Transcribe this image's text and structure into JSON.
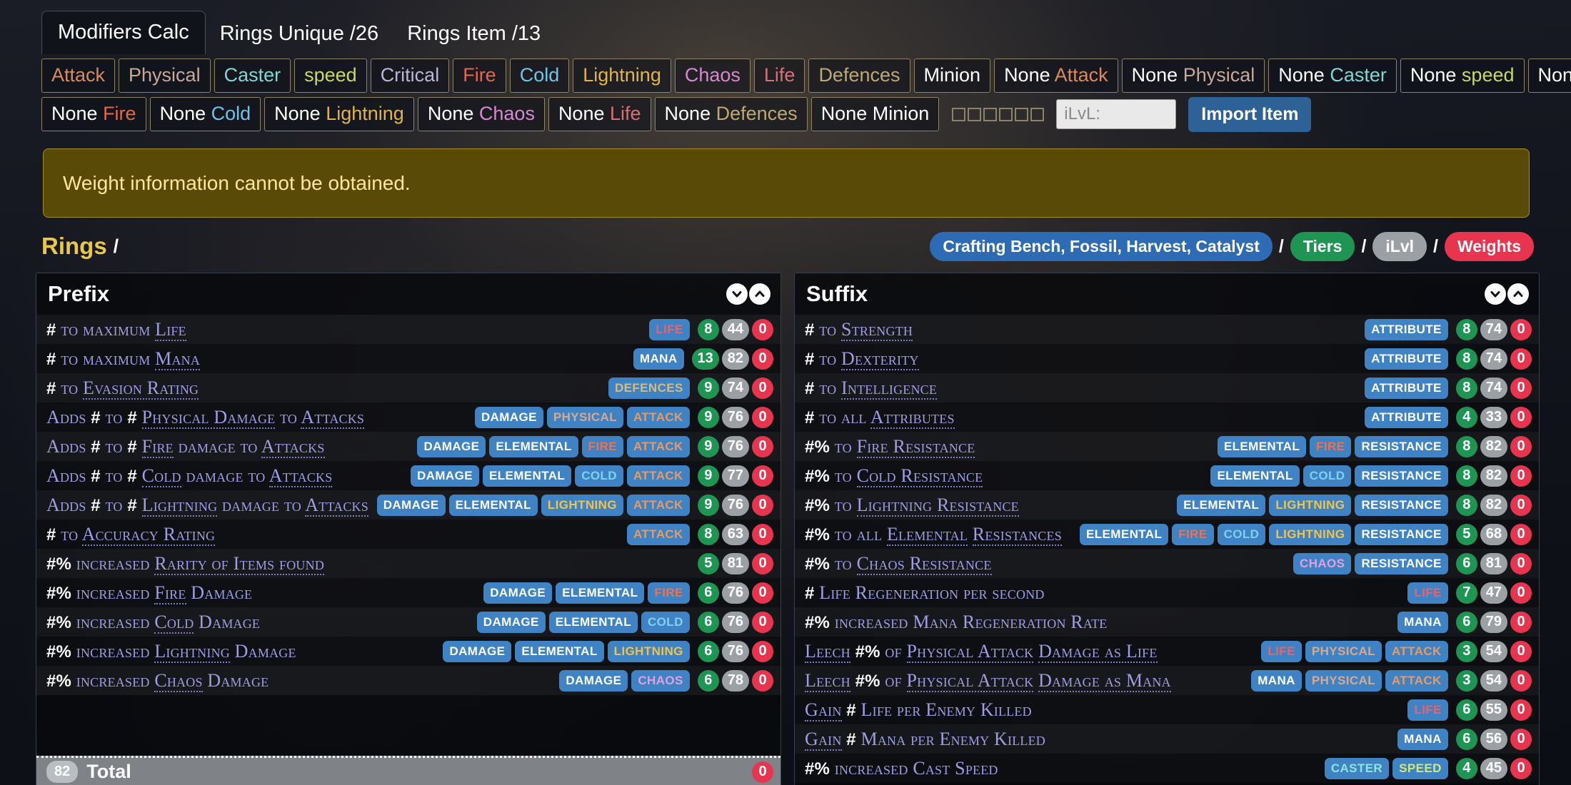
{
  "tabs": [
    {
      "label": "Modifiers Calc",
      "active": true
    },
    {
      "label": "Rings Unique /26",
      "active": false
    },
    {
      "label": "Rings Item /13",
      "active": false
    }
  ],
  "filter_row_1": [
    {
      "prefix": "",
      "label": "Attack",
      "color": "#d98a5e"
    },
    {
      "prefix": "",
      "label": "Physical",
      "color": "#c7a99a"
    },
    {
      "prefix": "",
      "label": "Caster",
      "color": "#7fd8d0"
    },
    {
      "prefix": "",
      "label": "speed",
      "color": "#c6d86a"
    },
    {
      "prefix": "",
      "label": "Critical",
      "color": "#b8b6d8"
    },
    {
      "prefix": "",
      "label": "Fire",
      "color": "#e06a4a"
    },
    {
      "prefix": "",
      "label": "Cold",
      "color": "#6fc4e8"
    },
    {
      "prefix": "",
      "label": "Lightning",
      "color": "#e0b44a"
    },
    {
      "prefix": "",
      "label": "Chaos",
      "color": "#d58ad0"
    },
    {
      "prefix": "",
      "label": "Life",
      "color": "#d8707a"
    },
    {
      "prefix": "",
      "label": "Defences",
      "color": "#bfa878"
    },
    {
      "prefix": "",
      "label": "Minion",
      "color": "#ffffff"
    },
    {
      "prefix": "None ",
      "label": "Attack",
      "color": "#d98a5e"
    },
    {
      "prefix": "None ",
      "label": "Physical",
      "color": "#c7a99a"
    },
    {
      "prefix": "None ",
      "label": "Caster",
      "color": "#7fd8d0"
    },
    {
      "prefix": "None ",
      "label": "speed",
      "color": "#c6d86a"
    },
    {
      "prefix": "None ",
      "label": "Critical",
      "color": "#b8b6d8"
    }
  ],
  "filter_row_2": [
    {
      "prefix": "None ",
      "label": "Fire",
      "color": "#e06a4a"
    },
    {
      "prefix": "None ",
      "label": "Cold",
      "color": "#6fc4e8"
    },
    {
      "prefix": "None ",
      "label": "Lightning",
      "color": "#e0b44a"
    },
    {
      "prefix": "None ",
      "label": "Chaos",
      "color": "#d58ad0"
    },
    {
      "prefix": "None ",
      "label": "Life",
      "color": "#d8707a"
    },
    {
      "prefix": "None ",
      "label": "Defences",
      "color": "#bfa878"
    },
    {
      "prefix": "None ",
      "label": "Minion",
      "color": "#ffffff"
    }
  ],
  "checkbox_count": 6,
  "ilvl": {
    "placeholder": "iLvL:",
    "value": ""
  },
  "import_button": "Import Item",
  "warning": "Weight information cannot be obtained.",
  "rings": {
    "title": "Rings",
    "slash": "/"
  },
  "header_pills": [
    {
      "label": "Crafting Bench, Fossil, Harvest, Catalyst",
      "style": "blue"
    },
    {
      "label": "Tiers",
      "style": "green"
    },
    {
      "label": "iLvl",
      "style": "gray"
    },
    {
      "label": "Weights",
      "style": "red"
    }
  ],
  "pill_separator": "/",
  "colors": {
    "accent_gold": "#e8c84a",
    "tag_blue": "#3f83c4",
    "num_green": "#1e9553",
    "num_gray": "#9ba0a5",
    "num_red": "#e8354f",
    "mod_text": "#9f9ee4",
    "warning_bg": "#594a07",
    "warning_text": "#ffe79a",
    "import_blue": "#2e6196"
  },
  "tag_colors": {
    "DAMAGE": "#ffffff",
    "PHYSICAL": "#d9a890",
    "ELEMENTAL": "#ffffff",
    "FIRE": "#f0714a",
    "COLD": "#7fd0f5",
    "LIGHTNING": "#f0c44a",
    "CHAOS": "#e3a0dd",
    "ATTACK": "#e89a62",
    "CASTER": "#8fe5dd",
    "SPEED": "#d2e87a",
    "LIFE": "#e8636e",
    "MANA": "#ffffff",
    "DEFENCES": "#d2bc84",
    "ATTRIBUTE": "#ffffff",
    "RESISTANCE": "#ffffff"
  },
  "prefix": {
    "title": "Prefix",
    "rows": [
      {
        "parts": [
          {
            "t": "#",
            "k": "hash"
          },
          {
            "t": " to maximum ",
            "k": "p"
          },
          {
            "t": "Life",
            "k": "u"
          }
        ],
        "tags": [
          "LIFE"
        ],
        "nums": [
          8,
          44,
          0
        ]
      },
      {
        "parts": [
          {
            "t": "#",
            "k": "hash"
          },
          {
            "t": " to maximum ",
            "k": "p"
          },
          {
            "t": "Mana",
            "k": "u"
          }
        ],
        "tags": [
          "MANA"
        ],
        "nums": [
          13,
          82,
          0
        ]
      },
      {
        "parts": [
          {
            "t": "#",
            "k": "hash"
          },
          {
            "t": " to ",
            "k": "p"
          },
          {
            "t": "Evasion Rating",
            "k": "u"
          }
        ],
        "tags": [
          "DEFENCES"
        ],
        "nums": [
          9,
          74,
          0
        ]
      },
      {
        "parts": [
          {
            "t": "Adds ",
            "k": "p"
          },
          {
            "t": "#",
            "k": "hash"
          },
          {
            "t": " to ",
            "k": "p"
          },
          {
            "t": "#",
            "k": "hash"
          },
          {
            "t": " ",
            "k": "p"
          },
          {
            "t": "Physical Damage",
            "k": "u"
          },
          {
            "t": " to ",
            "k": "p"
          },
          {
            "t": "Attacks",
            "k": "u"
          }
        ],
        "tags": [
          "DAMAGE",
          "PHYSICAL",
          "ATTACK"
        ],
        "nums": [
          9,
          76,
          0
        ]
      },
      {
        "parts": [
          {
            "t": "Adds ",
            "k": "p"
          },
          {
            "t": "#",
            "k": "hash"
          },
          {
            "t": " to ",
            "k": "p"
          },
          {
            "t": "#",
            "k": "hash"
          },
          {
            "t": " ",
            "k": "p"
          },
          {
            "t": "Fire",
            "k": "u"
          },
          {
            "t": " damage to ",
            "k": "p"
          },
          {
            "t": "Attacks",
            "k": "u"
          }
        ],
        "tags": [
          "DAMAGE",
          "ELEMENTAL",
          "FIRE",
          "ATTACK"
        ],
        "nums": [
          9,
          76,
          0
        ]
      },
      {
        "parts": [
          {
            "t": "Adds ",
            "k": "p"
          },
          {
            "t": "#",
            "k": "hash"
          },
          {
            "t": " to ",
            "k": "p"
          },
          {
            "t": "#",
            "k": "hash"
          },
          {
            "t": " ",
            "k": "p"
          },
          {
            "t": "Cold",
            "k": "u"
          },
          {
            "t": " damage to ",
            "k": "p"
          },
          {
            "t": "Attacks",
            "k": "u"
          }
        ],
        "tags": [
          "DAMAGE",
          "ELEMENTAL",
          "COLD",
          "ATTACK"
        ],
        "nums": [
          9,
          77,
          0
        ]
      },
      {
        "parts": [
          {
            "t": "Adds ",
            "k": "p"
          },
          {
            "t": "#",
            "k": "hash"
          },
          {
            "t": " to ",
            "k": "p"
          },
          {
            "t": "#",
            "k": "hash"
          },
          {
            "t": " ",
            "k": "p"
          },
          {
            "t": "Lightning",
            "k": "u"
          },
          {
            "t": " damage to ",
            "k": "p"
          },
          {
            "t": "Attacks",
            "k": "u"
          }
        ],
        "tags": [
          "DAMAGE",
          "ELEMENTAL",
          "LIGHTNING",
          "ATTACK"
        ],
        "nums": [
          9,
          76,
          0
        ]
      },
      {
        "parts": [
          {
            "t": "#",
            "k": "hash"
          },
          {
            "t": " to ",
            "k": "p"
          },
          {
            "t": "Accuracy Rating",
            "k": "u"
          }
        ],
        "tags": [
          "ATTACK"
        ],
        "nums": [
          8,
          63,
          0
        ]
      },
      {
        "parts": [
          {
            "t": "#%",
            "k": "hash"
          },
          {
            "t": " increased ",
            "k": "p"
          },
          {
            "t": "Rarity of Items found",
            "k": "u"
          }
        ],
        "tags": [],
        "nums": [
          5,
          81,
          0
        ]
      },
      {
        "parts": [
          {
            "t": "#%",
            "k": "hash"
          },
          {
            "t": " increased ",
            "k": "p"
          },
          {
            "t": "Fire",
            "k": "u"
          },
          {
            "t": " Damage",
            "k": "p"
          }
        ],
        "tags": [
          "DAMAGE",
          "ELEMENTAL",
          "FIRE"
        ],
        "nums": [
          6,
          76,
          0
        ]
      },
      {
        "parts": [
          {
            "t": "#%",
            "k": "hash"
          },
          {
            "t": " increased ",
            "k": "p"
          },
          {
            "t": "Cold",
            "k": "u"
          },
          {
            "t": " Damage",
            "k": "p"
          }
        ],
        "tags": [
          "DAMAGE",
          "ELEMENTAL",
          "COLD"
        ],
        "nums": [
          6,
          76,
          0
        ]
      },
      {
        "parts": [
          {
            "t": "#%",
            "k": "hash"
          },
          {
            "t": " increased ",
            "k": "p"
          },
          {
            "t": "Lightning",
            "k": "u"
          },
          {
            "t": " Damage",
            "k": "p"
          }
        ],
        "tags": [
          "DAMAGE",
          "ELEMENTAL",
          "LIGHTNING"
        ],
        "nums": [
          6,
          76,
          0
        ]
      },
      {
        "parts": [
          {
            "t": "#%",
            "k": "hash"
          },
          {
            "t": " increased ",
            "k": "p"
          },
          {
            "t": "Chaos",
            "k": "u"
          },
          {
            "t": " Damage",
            "k": "p"
          }
        ],
        "tags": [
          "DAMAGE",
          "CHAOS"
        ],
        "nums": [
          6,
          78,
          0
        ]
      }
    ],
    "total": {
      "count": 82,
      "label": "Total",
      "right": 0
    }
  },
  "suffix": {
    "title": "Suffix",
    "rows": [
      {
        "parts": [
          {
            "t": "#",
            "k": "hash"
          },
          {
            "t": " to ",
            "k": "p"
          },
          {
            "t": "Strength",
            "k": "u"
          }
        ],
        "tags": [
          "ATTRIBUTE"
        ],
        "nums": [
          8,
          74,
          0
        ]
      },
      {
        "parts": [
          {
            "t": "#",
            "k": "hash"
          },
          {
            "t": " to ",
            "k": "p"
          },
          {
            "t": "Dexterity",
            "k": "u"
          }
        ],
        "tags": [
          "ATTRIBUTE"
        ],
        "nums": [
          8,
          74,
          0
        ]
      },
      {
        "parts": [
          {
            "t": "#",
            "k": "hash"
          },
          {
            "t": " to ",
            "k": "p"
          },
          {
            "t": "Intelligence",
            "k": "u"
          }
        ],
        "tags": [
          "ATTRIBUTE"
        ],
        "nums": [
          8,
          74,
          0
        ]
      },
      {
        "parts": [
          {
            "t": "#",
            "k": "hash"
          },
          {
            "t": " to all ",
            "k": "p"
          },
          {
            "t": "Attributes",
            "k": "u"
          }
        ],
        "tags": [
          "ATTRIBUTE"
        ],
        "nums": [
          4,
          33,
          0
        ]
      },
      {
        "parts": [
          {
            "t": "#%",
            "k": "hash"
          },
          {
            "t": " to ",
            "k": "p"
          },
          {
            "t": "Fire Resistance",
            "k": "u"
          }
        ],
        "tags": [
          "ELEMENTAL",
          "FIRE",
          "RESISTANCE"
        ],
        "nums": [
          8,
          82,
          0
        ]
      },
      {
        "parts": [
          {
            "t": "#%",
            "k": "hash"
          },
          {
            "t": " to ",
            "k": "p"
          },
          {
            "t": "Cold Resistance",
            "k": "u"
          }
        ],
        "tags": [
          "ELEMENTAL",
          "COLD",
          "RESISTANCE"
        ],
        "nums": [
          8,
          82,
          0
        ]
      },
      {
        "parts": [
          {
            "t": "#%",
            "k": "hash"
          },
          {
            "t": " to ",
            "k": "p"
          },
          {
            "t": "Lightning Resistance",
            "k": "u"
          }
        ],
        "tags": [
          "ELEMENTAL",
          "LIGHTNING",
          "RESISTANCE"
        ],
        "nums": [
          8,
          82,
          0
        ]
      },
      {
        "parts": [
          {
            "t": "#%",
            "k": "hash"
          },
          {
            "t": " to all ",
            "k": "p"
          },
          {
            "t": "Elemental",
            "k": "u"
          },
          {
            "t": " ",
            "k": "p"
          },
          {
            "t": "Resistances",
            "k": "u"
          }
        ],
        "tags": [
          "ELEMENTAL",
          "FIRE",
          "COLD",
          "LIGHTNING",
          "RESISTANCE"
        ],
        "nums": [
          5,
          68,
          0
        ]
      },
      {
        "parts": [
          {
            "t": "#%",
            "k": "hash"
          },
          {
            "t": " to ",
            "k": "p"
          },
          {
            "t": "Chaos Resistance",
            "k": "u"
          }
        ],
        "tags": [
          "CHAOS",
          "RESISTANCE"
        ],
        "nums": [
          6,
          81,
          0
        ]
      },
      {
        "parts": [
          {
            "t": "#",
            "k": "hash"
          },
          {
            "t": " ",
            "k": "p"
          },
          {
            "t": "Life Regeneration per second",
            "k": "p"
          }
        ],
        "tags": [
          "LIFE"
        ],
        "nums": [
          7,
          47,
          0
        ]
      },
      {
        "parts": [
          {
            "t": "#%",
            "k": "hash"
          },
          {
            "t": " increased ",
            "k": "p"
          },
          {
            "t": "Mana Regeneration Rate",
            "k": "p"
          }
        ],
        "tags": [
          "MANA"
        ],
        "nums": [
          6,
          79,
          0
        ]
      },
      {
        "parts": [
          {
            "t": "Leech",
            "k": "u"
          },
          {
            "t": " ",
            "k": "p"
          },
          {
            "t": "#%",
            "k": "hash"
          },
          {
            "t": " of ",
            "k": "p"
          },
          {
            "t": "Physical Attack",
            "k": "u"
          },
          {
            "t": " ",
            "k": "p"
          },
          {
            "t": "Damage as Life",
            "k": "u"
          }
        ],
        "tags": [
          "LIFE",
          "PHYSICAL",
          "ATTACK"
        ],
        "nums": [
          3,
          54,
          0
        ]
      },
      {
        "parts": [
          {
            "t": "Leech",
            "k": "u"
          },
          {
            "t": " ",
            "k": "p"
          },
          {
            "t": "#%",
            "k": "hash"
          },
          {
            "t": " of ",
            "k": "p"
          },
          {
            "t": "Physical Attack",
            "k": "u"
          },
          {
            "t": " ",
            "k": "p"
          },
          {
            "t": "Damage as Mana",
            "k": "u"
          }
        ],
        "tags": [
          "MANA",
          "PHYSICAL",
          "ATTACK"
        ],
        "nums": [
          3,
          54,
          0
        ]
      },
      {
        "parts": [
          {
            "t": "Gain",
            "k": "u"
          },
          {
            "t": " ",
            "k": "p"
          },
          {
            "t": "#",
            "k": "hash"
          },
          {
            "t": " Life per Enemy Killed",
            "k": "p"
          }
        ],
        "tags": [
          "LIFE"
        ],
        "nums": [
          6,
          55,
          0
        ]
      },
      {
        "parts": [
          {
            "t": "Gain",
            "k": "u"
          },
          {
            "t": " ",
            "k": "p"
          },
          {
            "t": "#",
            "k": "hash"
          },
          {
            "t": " Mana per Enemy Killed",
            "k": "p"
          }
        ],
        "tags": [
          "MANA"
        ],
        "nums": [
          6,
          56,
          0
        ]
      },
      {
        "parts": [
          {
            "t": "#%",
            "k": "hash"
          },
          {
            "t": " increased ",
            "k": "p"
          },
          {
            "t": "Cast Speed",
            "k": "p"
          }
        ],
        "tags": [
          "CASTER",
          "SPEED"
        ],
        "nums": [
          4,
          45,
          0
        ]
      }
    ]
  }
}
